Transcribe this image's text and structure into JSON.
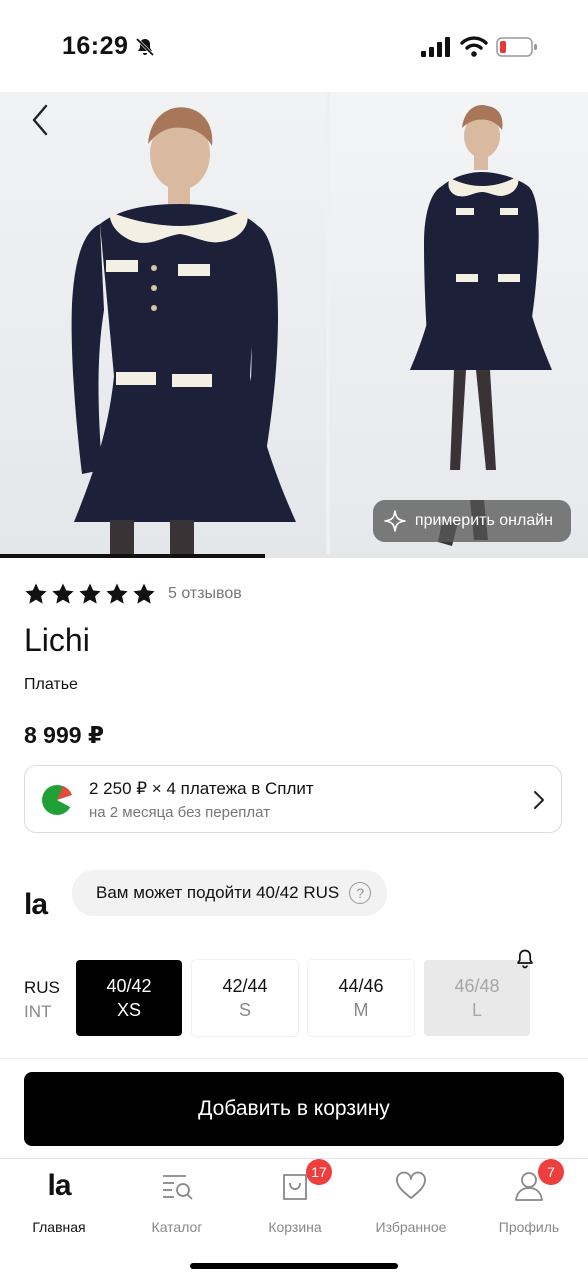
{
  "status_bar": {
    "time": "16:29",
    "battery_color": "#e53935"
  },
  "gallery": {
    "try_on_label": "примерить онлайн",
    "current_slide": 1,
    "slide_count": 2,
    "progress_fraction": 0.45,
    "dress_color": "#1c2038"
  },
  "product": {
    "rating_stars": 5,
    "reviews": "5 отзывов",
    "brand": "Lichi",
    "type": "Платье",
    "price": "8 999 ₽"
  },
  "split": {
    "line1": "2 250 ₽ × 4 платежа в Сплит",
    "line2": "на 2 месяца без переплат",
    "logo_color": "#21a038"
  },
  "size_advice": {
    "logo": "la",
    "text": "Вам может подойти 40/42 RUS",
    "help_icon": "?"
  },
  "sizes": {
    "system_primary": "RUS",
    "system_secondary": "INT",
    "options": [
      {
        "rus": "40/42",
        "int": "XS",
        "state": "selected"
      },
      {
        "rus": "42/44",
        "int": "S",
        "state": "available"
      },
      {
        "rus": "44/46",
        "int": "M",
        "state": "available"
      },
      {
        "rus": "46/48",
        "int": "L",
        "state": "unavailable"
      }
    ]
  },
  "add_to_cart": "Добавить в корзину",
  "tabs": [
    {
      "label": "Главная",
      "icon": "la-logo-icon",
      "badge": ""
    },
    {
      "label": "Каталог",
      "icon": "catalog-search-icon",
      "badge": ""
    },
    {
      "label": "Корзина",
      "icon": "shopping-bag-icon",
      "badge": "17"
    },
    {
      "label": "Избранное",
      "icon": "heart-icon",
      "badge": ""
    },
    {
      "label": "Профиль",
      "icon": "profile-icon",
      "badge": "7"
    }
  ],
  "accent_badge_color": "#ef3e3e"
}
